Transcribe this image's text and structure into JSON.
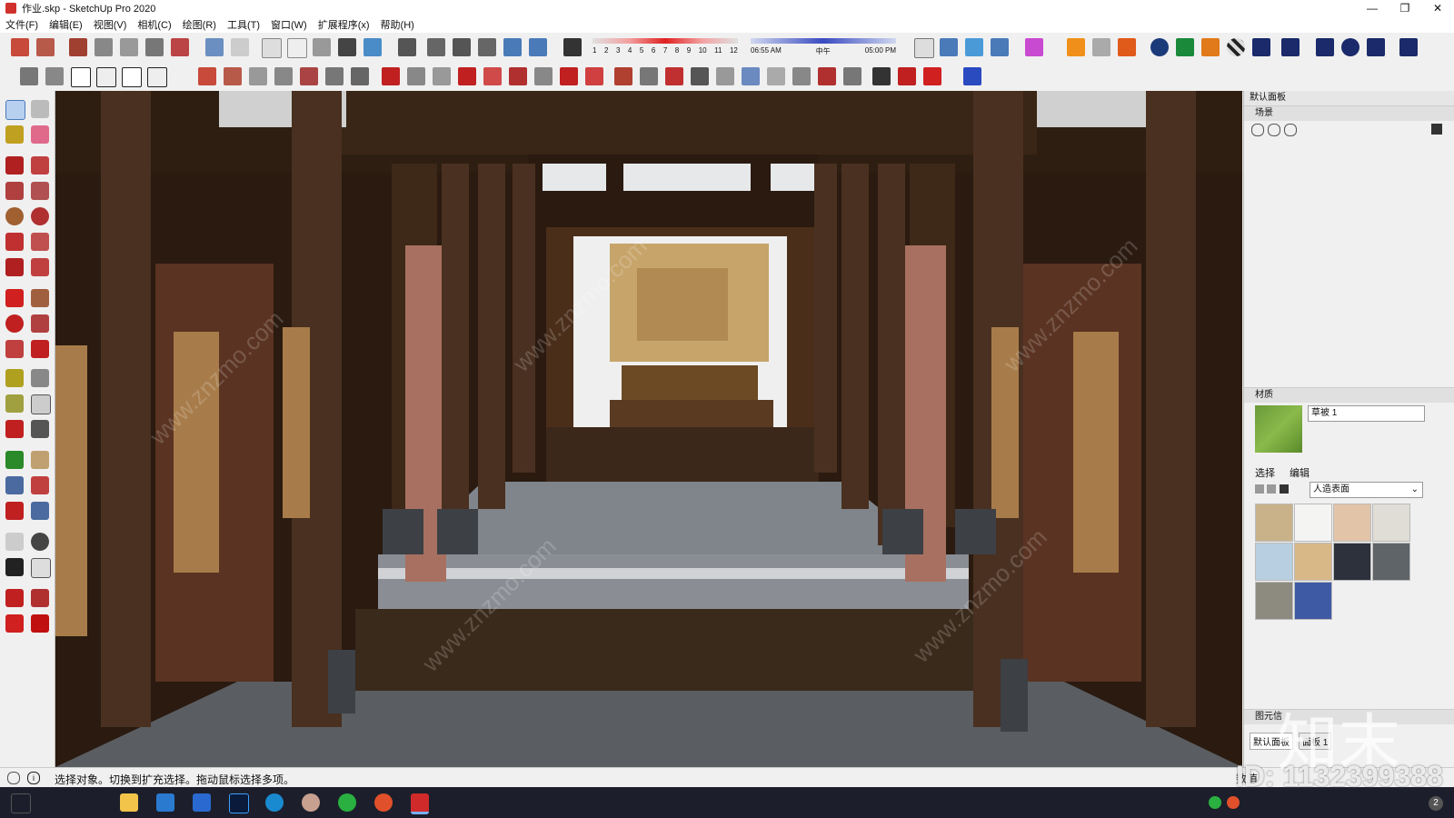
{
  "window": {
    "title": "作业.skp - SketchUp Pro 2020"
  },
  "menu": [
    "文件(F)",
    "编辑(E)",
    "视图(V)",
    "相机(C)",
    "绘图(R)",
    "工具(T)",
    "窗口(W)",
    "扩展程序(x)",
    "帮助(H)"
  ],
  "shadow": {
    "months": [
      "1",
      "2",
      "3",
      "4",
      "5",
      "6",
      "7",
      "8",
      "9",
      "10",
      "11",
      "12"
    ],
    "time_start": "06:55 AM",
    "noon": "中午",
    "time_end": "05:00 PM"
  },
  "panel": {
    "title": "默认面板",
    "scenes_title": "场景",
    "materials_title": "材质",
    "material_name": "草被 1",
    "tab_select": "选择",
    "tab_edit": "编辑",
    "library": "人造表面",
    "components_title": "图元信",
    "bottom_tabs": [
      "默认面板",
      "面板 1"
    ],
    "swatch_colors": [
      "#c9b28a",
      "#f4f4f2",
      "#e2c4a8",
      "#e0ddd6",
      "#b7cfe0",
      "#d9b888",
      "#2c313c",
      "#5e6468",
      "#8d8b80",
      "#3e5aa4"
    ]
  },
  "status": {
    "text": "选择对象。切换到扩充选择。拖动鼠标选择多项。",
    "right_label": "数值"
  },
  "watermark": {
    "text": "www.znzmo.com",
    "brand": "知末",
    "id": "ID: 1132399388"
  },
  "taskbar": {
    "clock": "2"
  }
}
